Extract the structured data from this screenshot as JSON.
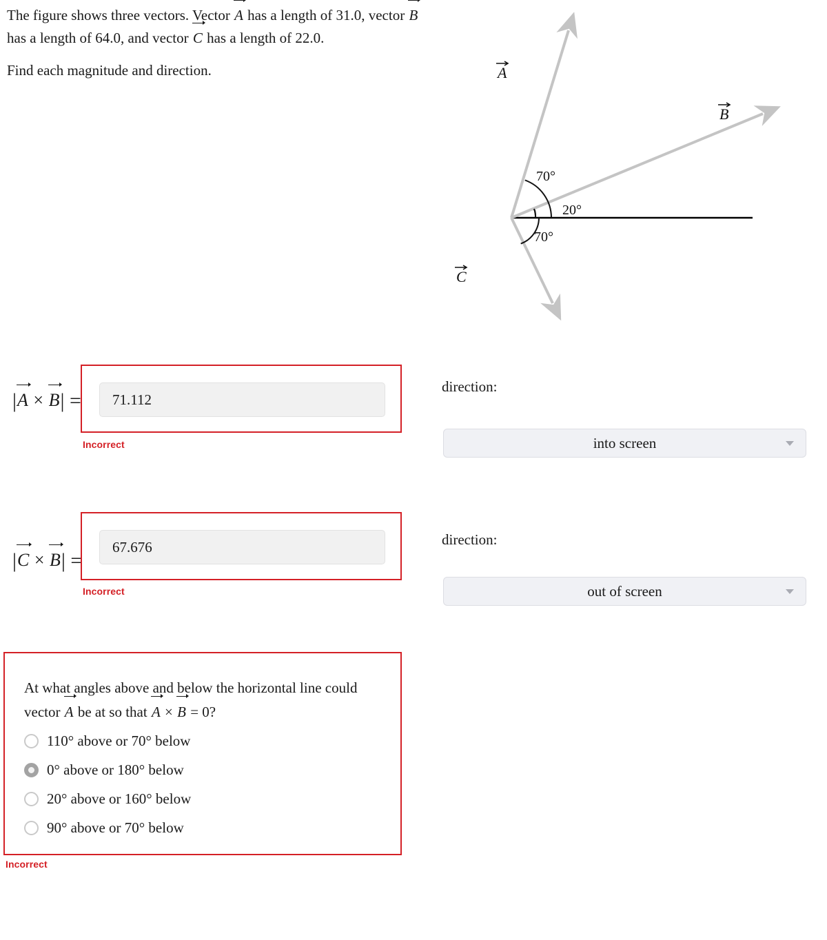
{
  "problem": {
    "line1_a": "The figure shows three vectors. Vector ",
    "line1_b": " has a length of 31.0, vector ",
    "line1_c": " has a length of 64.0, and vector ",
    "line1_d": " has a length of 22.0.",
    "instruction": "Find each magnitude and direction.",
    "vector_a": "A",
    "vector_b": "B",
    "vector_c": "C"
  },
  "figure": {
    "label_a": "A",
    "label_b": "B",
    "label_c": "C",
    "angle_a_above": "70°",
    "angle_b_above": "20°",
    "angle_c_below": "70°",
    "vector_color": "#c4c4c4",
    "axis_color": "#000000"
  },
  "answers": [
    {
      "label_left": "|",
      "label_vec1": "A",
      "label_times": "×",
      "label_vec2": "B",
      "label_right": "| =",
      "value": "71.112",
      "status": "Incorrect",
      "direction_label": "direction:",
      "direction_value": "into screen"
    },
    {
      "label_left": "|",
      "label_vec1": "C",
      "label_times": "×",
      "label_vec2": "B",
      "label_right": "| =",
      "value": "67.676",
      "status": "Incorrect",
      "direction_label": "direction:",
      "direction_value": "out of screen"
    }
  ],
  "multiple_choice": {
    "question_a": "At what angles above and below the horizontal line could vector ",
    "question_b": " be at so that ",
    "question_c": " × ",
    "question_d": " = 0?",
    "vector_a": "A",
    "vector_b": "B",
    "options": [
      {
        "label": "110° above or 70° below",
        "selected": false
      },
      {
        "label": "0° above or 180° below",
        "selected": true
      },
      {
        "label": "20° above or 160° below",
        "selected": false
      },
      {
        "label": "90° above or 70° below",
        "selected": false
      }
    ],
    "status": "Incorrect"
  },
  "colors": {
    "error": "#d42026",
    "input_bg": "#f1f1f1",
    "dropdown_bg": "#f0f1f5"
  }
}
